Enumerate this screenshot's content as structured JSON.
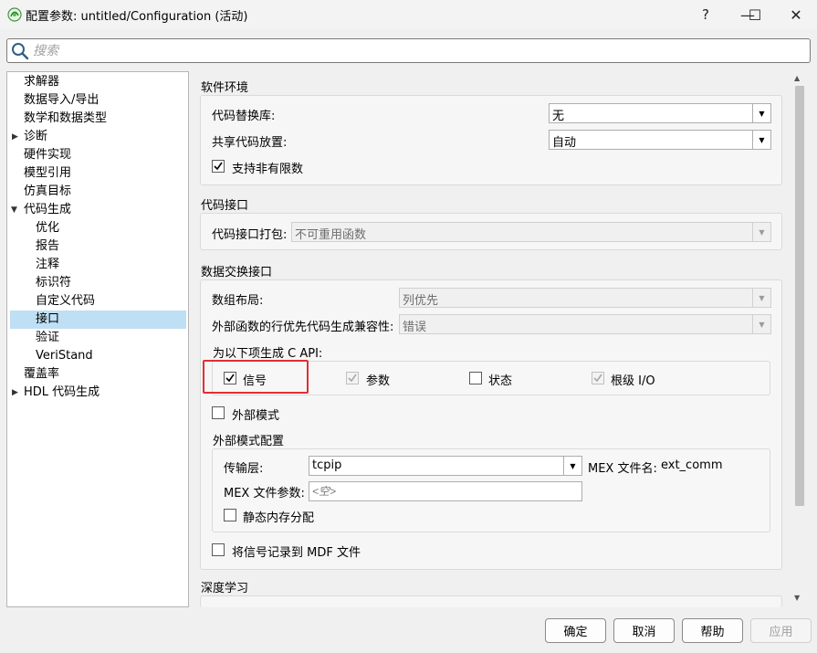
{
  "window": {
    "title": "配置参数: untitled/Configuration (活动)",
    "help_glyph": "?",
    "minimize_glyph": "—",
    "maximize_glyph": "☐",
    "close_glyph": "✕"
  },
  "search": {
    "placeholder": "搜索"
  },
  "tree": {
    "items": [
      {
        "label": "求解器"
      },
      {
        "label": "数据导入/导出"
      },
      {
        "label": "数学和数据类型"
      },
      {
        "label": "诊断",
        "expander": "▶"
      },
      {
        "label": "硬件实现"
      },
      {
        "label": "模型引用"
      },
      {
        "label": "仿真目标"
      },
      {
        "label": "代码生成",
        "expander": "▼"
      },
      {
        "label": "优化"
      },
      {
        "label": "报告"
      },
      {
        "label": "注释"
      },
      {
        "label": "标识符"
      },
      {
        "label": "自定义代码"
      },
      {
        "label": "接口"
      },
      {
        "label": "验证"
      },
      {
        "label": "VeriStand"
      },
      {
        "label": "覆盖率"
      },
      {
        "label": "HDL 代码生成",
        "expander": "▶"
      }
    ],
    "selected": "接口"
  },
  "software_env": {
    "section_title": "软件环境",
    "code_replacement_label": "代码替换库:",
    "code_replacement_value": "无",
    "shared_code_label": "共享代码放置:",
    "shared_code_value": "自动",
    "nonfinite_label": "支持非有限数"
  },
  "code_interface": {
    "section_title": "代码接口",
    "packaging_label": "代码接口打包:",
    "packaging_value": "不可重用函数"
  },
  "data_exchange": {
    "section_title": "数据交换接口",
    "array_layout_label": "数组布局:",
    "array_layout_value": "列优先",
    "row_major_label": "外部函数的行优先代码生成兼容性:",
    "row_major_value": "错误",
    "c_api_label": "为以下项生成 C API:",
    "signals_label": "信号",
    "params_label": "参数",
    "states_label": "状态",
    "root_io_label": "根级 I/O",
    "external_mode_label": "外部模式",
    "ext_config_title": "外部模式配置",
    "transport_label": "传输层:",
    "transport_value": "tcpip",
    "mex_file_label": "MEX 文件名:",
    "mex_file_value": "ext_comm",
    "mex_args_label": "MEX 文件参数:",
    "mex_args_placeholder": "<空>",
    "static_mem_label": "静态内存分配",
    "mdf_label": "将信号记录到 MDF 文件"
  },
  "deep_learning": {
    "section_title": "深度学习"
  },
  "buttons": {
    "ok": "确定",
    "cancel": "取消",
    "help": "帮助",
    "apply": "应用"
  },
  "colors": {
    "accent_selected": "#bfdff5",
    "highlight_border": "#e03030"
  }
}
